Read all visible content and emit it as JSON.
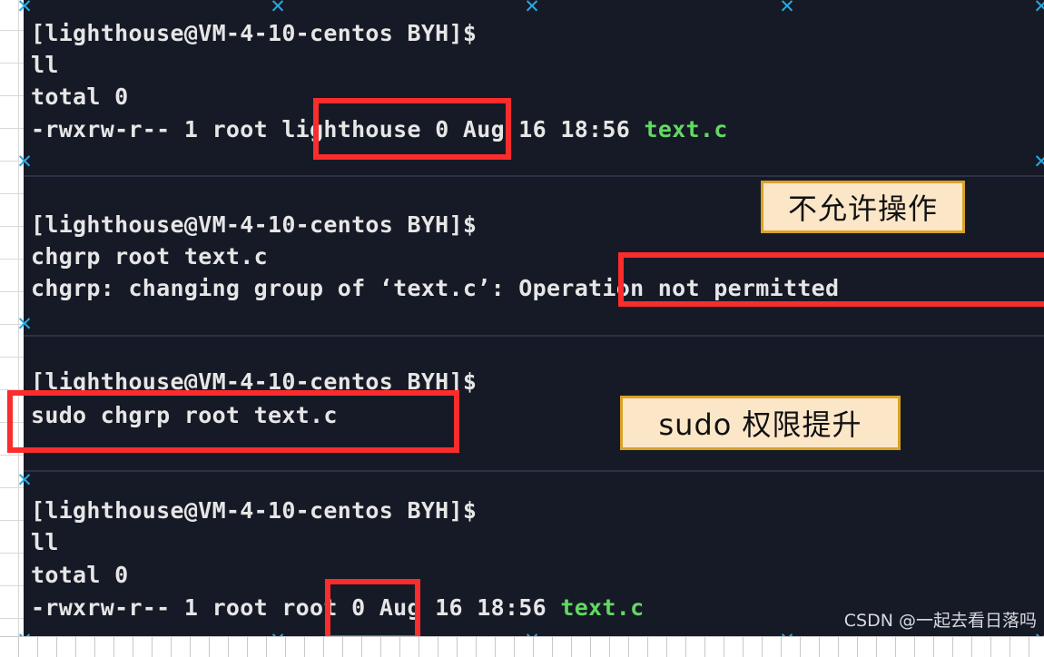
{
  "meta": {
    "terminal_bg": "#161a26",
    "text_color": "#e6e6e6",
    "file_color": "#62d862",
    "highlight_color": "#fb2c2c",
    "callout_bg": "#fce6c8",
    "callout_border": "#d8a227"
  },
  "terminal": {
    "blocks": [
      {
        "prompt": "[lighthouse@VM-4-10-centos BYH]$",
        "command": "ll",
        "output_total": "total 0",
        "listing_prefix": "-rwxrw-r-- 1 root ",
        "listing_group": "lighthouse",
        "listing_middle": " 0 Aug 16 18:56 ",
        "listing_file": "text.c"
      },
      {
        "prompt": "[lighthouse@VM-4-10-centos BYH]$",
        "command": "chgrp root text.c",
        "error_prefix": "chgrp: changing group of ‘text.c’: ",
        "error_highlight": "Operation not permitted"
      },
      {
        "prompt": "[lighthouse@VM-4-10-centos BYH]$",
        "command": "sudo chgrp root text.c"
      },
      {
        "prompt": "[lighthouse@VM-4-10-centos BYH]$",
        "command": "ll",
        "output_total": "total 0",
        "listing_prefix": "-rwxrw-r-- 1 root ",
        "listing_group": "root",
        "listing_middle": " 0 Aug 16 18:56 ",
        "listing_file": "text.c"
      }
    ]
  },
  "callouts": {
    "not_permitted": "不允许操作",
    "sudo_elevation": "sudo 权限提升"
  },
  "watermark": {
    "text": "CSDN @一起去看日落吗"
  },
  "markers": {
    "glyph": "✕"
  }
}
